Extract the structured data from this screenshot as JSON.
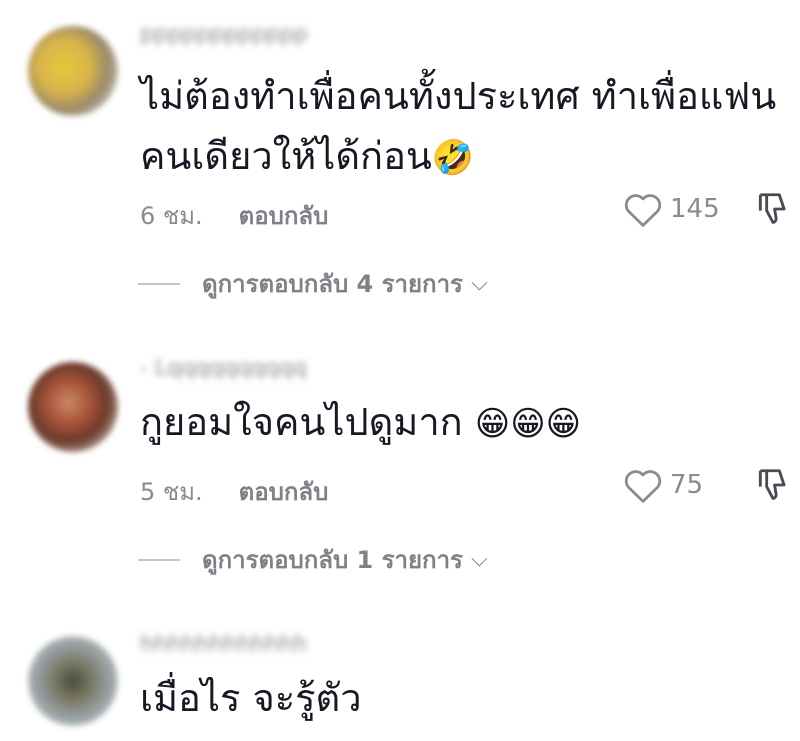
{
  "comments": [
    {
      "username": "pppppppppppp",
      "text_lines": [
        "ไม่ต้องทำเพื่อคนทั้งประเทศ ทำเพื่อแฟน",
        "คนเดียวให้ได้ก่อน"
      ],
      "emoji": "🤣",
      "time": "6 ชม.",
      "reply_label": "ตอบกลับ",
      "likes": "145",
      "view_replies": "ดูการตอบกลับ 4 รายการ"
    },
    {
      "username": "- Lqqqqqqqqqq",
      "text_lines": [
        "กูยอมใจคนไปดูมาก"
      ],
      "emoji": "😁😁😁",
      "time": "5 ชม.",
      "reply_label": "ตอบกลับ",
      "likes": "75",
      "view_replies": "ดูการตอบกลับ 1 รายการ"
    },
    {
      "username": "hhhhhhhhhhhh",
      "text_lines": [
        "เมื่อไร จะรู้ตัว"
      ]
    }
  ],
  "icons": {
    "like": "heart-outline-icon",
    "dislike": "thumbs-down-icon",
    "expand": "chevron-down-icon"
  },
  "colors": {
    "text": "#161823",
    "secondary": "#8a8b91"
  }
}
